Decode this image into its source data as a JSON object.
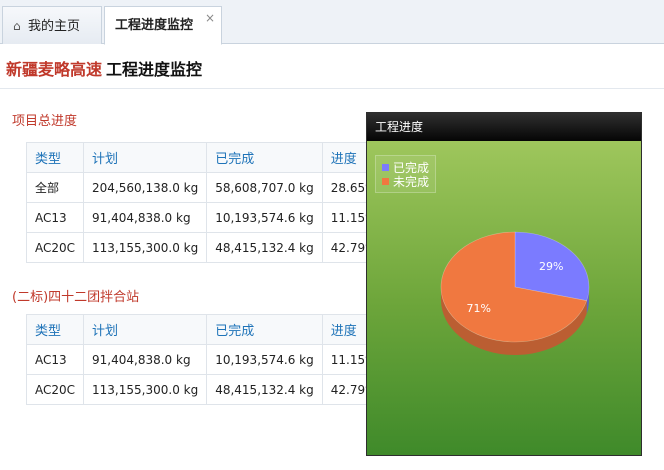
{
  "tabs": [
    {
      "label": "我的主页",
      "icon": "home-icon"
    },
    {
      "label": "工程进度监控",
      "close": "×"
    }
  ],
  "header": {
    "brand": "新疆麦略高速",
    "title": "工程进度监控"
  },
  "sections": [
    {
      "title": "项目总进度",
      "columns": [
        "类型",
        "计划",
        "已完成",
        "进度"
      ],
      "rows": [
        [
          "全部",
          "204,560,138.0 kg",
          "58,608,707.0 kg",
          "28.65%"
        ],
        [
          "AC13",
          "91,404,838.0 kg",
          "10,193,574.6 kg",
          "11.15%"
        ],
        [
          "AC20C",
          "113,155,300.0 kg",
          "48,415,132.4 kg",
          "42.79%"
        ]
      ]
    },
    {
      "title": "(二标)四十二团拌合站",
      "columns": [
        "类型",
        "计划",
        "已完成",
        "进度"
      ],
      "rows": [
        [
          "AC13",
          "91,404,838.0 kg",
          "10,193,574.6 kg",
          "11.15%"
        ],
        [
          "AC20C",
          "113,155,300.0 kg",
          "48,415,132.4 kg",
          "42.79%"
        ]
      ]
    }
  ],
  "chart_data": {
    "type": "pie",
    "title": "工程进度",
    "legend_position": "top-left",
    "slices": [
      {
        "label": "已完成",
        "value": 29,
        "display": "29%",
        "color": "#7b7bff"
      },
      {
        "label": "未完成",
        "value": 71,
        "display": "71%",
        "color": "#f07840"
      }
    ]
  }
}
